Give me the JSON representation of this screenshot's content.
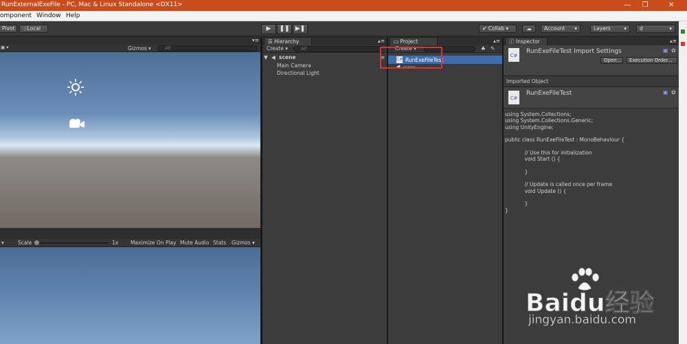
{
  "window": {
    "title": "RunExternalExeFile - PC, Mac & Linux Standalone <DX11>",
    "minimize": "—",
    "maximize": "❐",
    "close": "✕"
  },
  "menu": [
    "omponent",
    "Window",
    "Help"
  ],
  "toolbar": {
    "pivot": "Pivot",
    "local": "Local",
    "collab": "Collab ▾",
    "account": "Account",
    "layers": "Layers",
    "layout": "d"
  },
  "scene": {
    "gizmos": "Gizmos",
    "search_placeholder": "All"
  },
  "game": {
    "scale_label": "Scale",
    "scale_value": "1x",
    "maximize_on_play": "Maximize On Play",
    "mute_audio": "Mute Audio",
    "stats": "Stats",
    "gizmos": "Gizmos"
  },
  "hierarchy": {
    "tab": "Hierarchy",
    "create": "Create",
    "search_placeholder": "All",
    "scene_name": "scene",
    "items": [
      "Main Camera",
      "Directional Light"
    ]
  },
  "project": {
    "tab": "Project",
    "create": "Create",
    "selected_item": "RunExeFileTest",
    "second_item": "scene"
  },
  "inspector": {
    "tab": "Inspector",
    "header_title": "RunExeFileTest Import Settings",
    "open_btn": "Open...",
    "exec_order_btn": "Execution Order...",
    "imported_object_label": "Imported Object",
    "object_name": "RunExeFileTest",
    "code_lines": [
      "using System.Collections;",
      "using System.Collections.Generic;",
      "using UnityEngine;",
      "",
      "public class RunExeFileTest : MonoBehaviour {",
      "",
      "            // Use this for initialization",
      "            void Start () {",
      "",
      "            }",
      "",
      "            // Update is called once per frame",
      "            void Update () {",
      "",
      "            }",
      "}"
    ]
  },
  "watermark": {
    "brand": "Baidu经验",
    "url": "jingyan.baidu.com"
  },
  "colors": {
    "title_bar": "#c94d1c",
    "selection": "#3e6cb0",
    "highlight_box": "#e03030"
  }
}
